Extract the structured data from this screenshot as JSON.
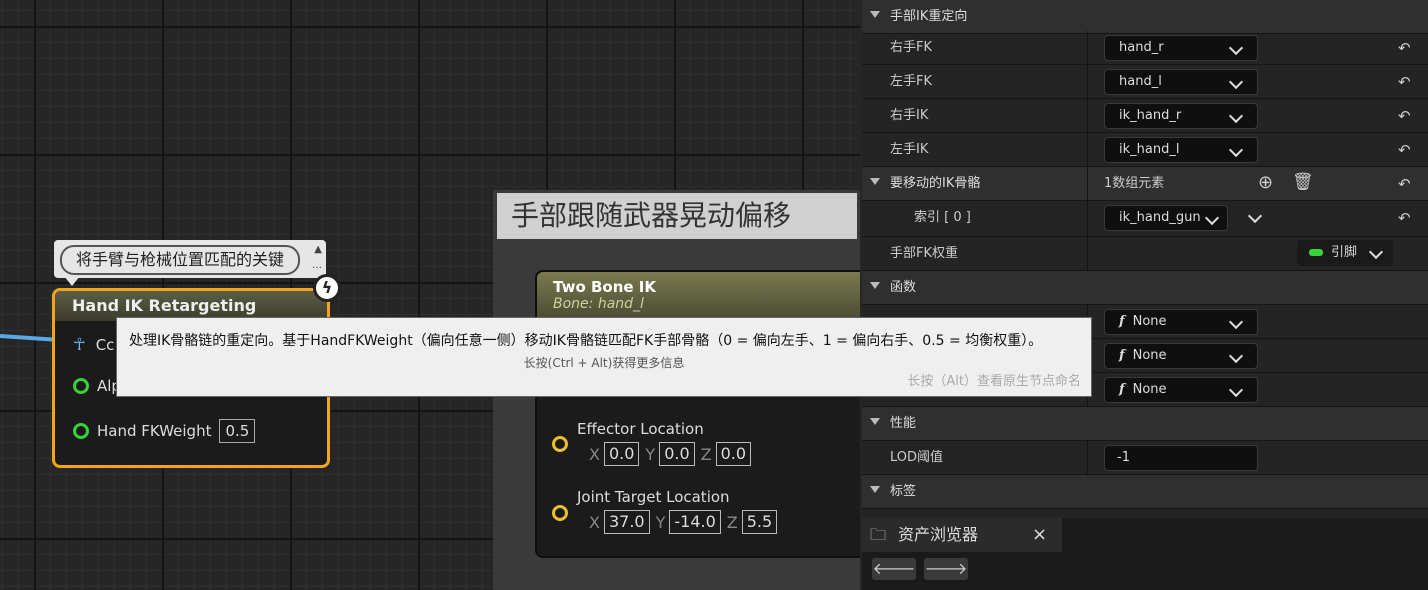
{
  "graph": {
    "comment_bubble": "将手臂与枪械位置匹配的关键",
    "hand_ik_node": {
      "title": "Hand IK Retargeting",
      "pin_component": "Cc",
      "pin_alpha": "Alp",
      "pin_weight_label": "Hand FKWeight",
      "pin_weight_value": "0.5"
    },
    "comment_box_title": "手部跟随武器晃动偏移",
    "two_bone_node": {
      "title": "Two Bone IK",
      "subtitle": "Bone: hand_l",
      "effector_label": "Effector Location",
      "effector": {
        "x": "0.0",
        "y": "0.0",
        "z": "0.0"
      },
      "joint_label": "Joint Target Location",
      "joint": {
        "x": "37.0",
        "y": "-14.0",
        "z": "5.5"
      },
      "axis_x": "X",
      "axis_y": "Y",
      "axis_z": "Z"
    },
    "tooltip": {
      "main": "处理IK骨骼链的重定向。基于HandFKWeight（偏向任意一侧）移动IK骨骼链匹配FK手部骨骼（0 = 偏向左手、1 = 偏向右手、0.5 = 均衡权重）。",
      "hint": "长按(Ctrl + Alt)获得更多信息",
      "hint2": "长按（Alt）查看原生节点命名"
    }
  },
  "details": {
    "cat_hand_ik": "手部IK重定向",
    "right_fk_label": "右手FK",
    "right_fk_value": "hand_r",
    "left_fk_label": "左手FK",
    "left_fk_value": "hand_l",
    "right_ik_label": "右手IK",
    "right_ik_value": "ik_hand_r",
    "left_ik_label": "左手IK",
    "left_ik_value": "ik_hand_l",
    "ik_bones_label": "要移动的IK骨骼",
    "ik_bones_count": "1数组元素",
    "index_label": "索引 [ 0 ]",
    "index_value": "ik_hand_gun",
    "fk_weight_label": "手部FK权重",
    "fk_weight_value": "引脚",
    "cat_functions": "函数",
    "func_none": "None",
    "cat_performance": "性能",
    "lod_label": "LOD阈值",
    "lod_value": "-1",
    "cat_tags": "标签"
  },
  "bottom": {
    "tab_label": "资产浏览器",
    "close": "×",
    "back": "🡐",
    "forward": "🡒"
  },
  "colors": {
    "selected_node_border": "#f2a41b",
    "exec_pin": "#39d139",
    "vector_pin": "#e7c130",
    "wire": "#5aa9e6"
  }
}
